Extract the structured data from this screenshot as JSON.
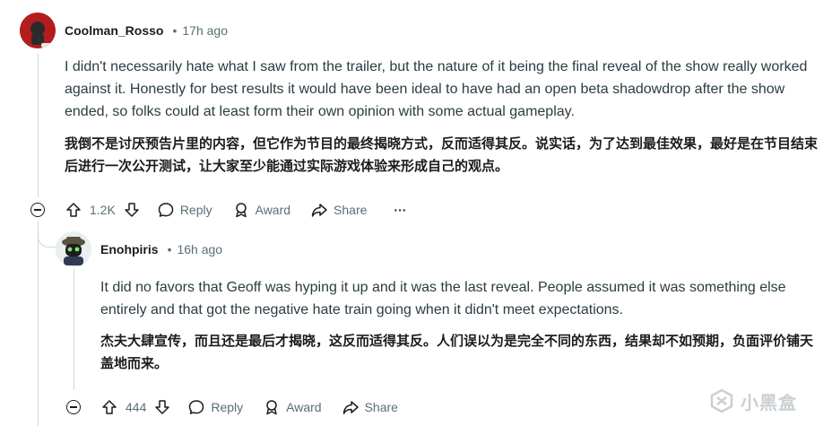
{
  "comment1": {
    "username": "Coolman_Rosso",
    "time": "17h ago",
    "text_en": "I didn't necessarily hate what I saw from the trailer, but the nature of it being the final reveal of the show really worked against it. Honestly for best results it would have been ideal to have had an open beta shadowdrop after the show ended, so folks could at least form their own opinion with some actual gameplay.",
    "text_cn": "我倒不是讨厌预告片里的内容，但它作为节目的最终揭晓方式，反而适得其反。说实话，为了达到最佳效果，最好是在节目结束后进行一次公开测试，让大家至少能通过实际游戏体验来形成自己的观点。",
    "votes": "1.2K",
    "reply_label": "Reply",
    "award_label": "Award",
    "share_label": "Share",
    "more_label": "···"
  },
  "comment2": {
    "username": "Enohpiris",
    "time": "16h ago",
    "text_en": "It did no favors that Geoff was hyping it up and it was the last reveal. People assumed it was something else entirely and that got the negative hate train going when it didn't meet expectations.",
    "text_cn": "杰夫大肆宣传，而且还是最后才揭晓，这反而适得其反。人们误以为是完全不同的东西，结果却不如预期，负面评价铺天盖地而来。",
    "votes": "444",
    "reply_label": "Reply",
    "award_label": "Award",
    "share_label": "Share"
  },
  "separator": "•",
  "watermark": "小黑盒",
  "colors": {
    "meta": "#576f76",
    "text": "#2a3c42",
    "thread": "#d0d7da"
  }
}
